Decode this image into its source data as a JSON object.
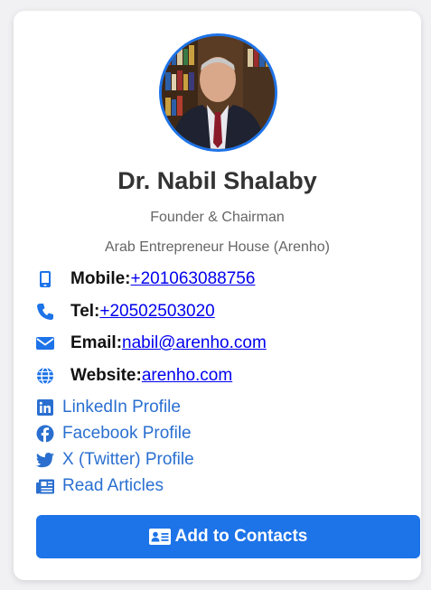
{
  "profile": {
    "name": "Dr. Nabil Shalaby",
    "title": "Founder & Chairman",
    "company": "Arab Entrepreneur House (Arenho)"
  },
  "contacts": {
    "mobile": {
      "label": "Mobile:",
      "value": "+201063088756",
      "icon": "mobile-phone-icon"
    },
    "tel": {
      "label": "Tel:",
      "value": "+20502503020",
      "icon": "phone-icon"
    },
    "email": {
      "label": "Email:",
      "value": "nabil@arenho.com",
      "icon": "envelope-icon"
    },
    "website": {
      "label": "Website:",
      "value": "arenho.com",
      "icon": "globe-icon"
    }
  },
  "social": {
    "linkedin": {
      "label": "LinkedIn Profile",
      "icon": "linkedin-icon"
    },
    "facebook": {
      "label": "Facebook Profile",
      "icon": "facebook-icon"
    },
    "twitter": {
      "label": "X (Twitter) Profile",
      "icon": "twitter-icon"
    },
    "articles": {
      "label": "Read Articles",
      "icon": "newspaper-icon"
    }
  },
  "action": {
    "add_contacts_label": "Add to Contacts",
    "icon": "contact-card-icon"
  },
  "colors": {
    "accent": "#1d73e8",
    "link": "#0000ee",
    "social": "#2a6fd0"
  }
}
